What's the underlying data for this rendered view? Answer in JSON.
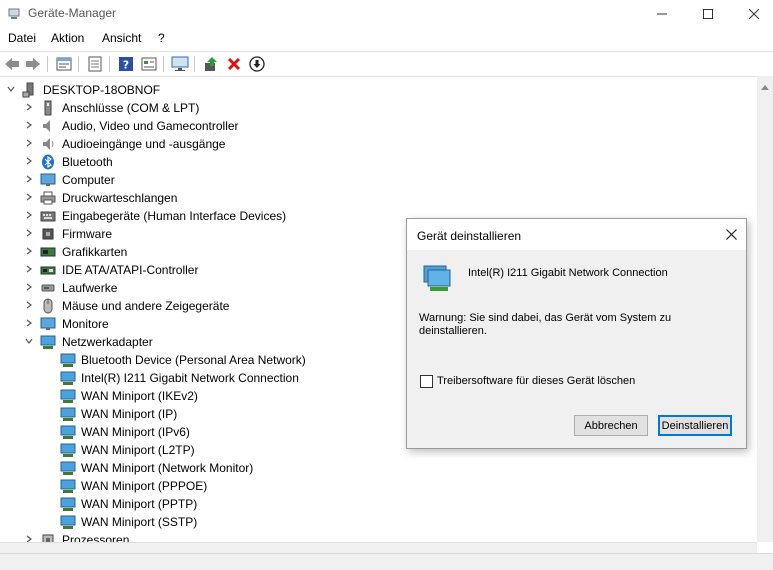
{
  "window": {
    "title": "Geräte-Manager",
    "minimize_icon": "minimize-icon",
    "maximize_icon": "maximize-icon",
    "close_icon": "close-icon"
  },
  "menu": [
    "Datei",
    "Aktion",
    "Ansicht",
    "?"
  ],
  "toolbar": [
    "back-arrow-icon",
    "forward-arrow-icon",
    "properties-sheet-icon",
    "update-list-icon",
    "help-icon",
    "show-hidden-icon",
    "monitor-scan-icon",
    "update-driver-icon",
    "uninstall-x-icon",
    "download-icon"
  ],
  "tree": {
    "root": "DESKTOP-18OBNOF",
    "categories": [
      {
        "label": "Anschlüsse (COM & LPT)"
      },
      {
        "label": "Audio, Video und Gamecontroller"
      },
      {
        "label": "Audioeingänge und -ausgänge"
      },
      {
        "label": "Bluetooth"
      },
      {
        "label": "Computer"
      },
      {
        "label": "Druckwarteschlangen"
      },
      {
        "label": "Eingabegeräte (Human Interface Devices)"
      },
      {
        "label": "Firmware"
      },
      {
        "label": "Grafikkarten"
      },
      {
        "label": "IDE ATA/ATAPI-Controller"
      },
      {
        "label": "Laufwerke"
      },
      {
        "label": "Mäuse und andere Zeigegeräte"
      },
      {
        "label": "Monitore"
      },
      {
        "label": "Netzwerkadapter"
      }
    ],
    "network_children": [
      "Bluetooth Device (Personal Area Network)",
      "Intel(R) I211 Gigabit Network Connection",
      "WAN Miniport (IKEv2)",
      "WAN Miniport (IP)",
      "WAN Miniport (IPv6)",
      "WAN Miniport (L2TP)",
      "WAN Miniport (Network Monitor)",
      "WAN Miniport (PPPOE)",
      "WAN Miniport (PPTP)",
      "WAN Miniport (SSTP)"
    ],
    "after": "Prozessoren"
  },
  "dialog": {
    "title": "Gerät deinstallieren",
    "device_name": "Intel(R) I211 Gigabit Network Connection",
    "warning": "Warnung: Sie sind dabei, das Gerät vom System zu deinstallieren.",
    "checkbox_label": "Treibersoftware für dieses Gerät löschen",
    "checkbox_checked": false,
    "cancel_label": "Abbrechen",
    "uninstall_label": "Deinstallieren"
  }
}
